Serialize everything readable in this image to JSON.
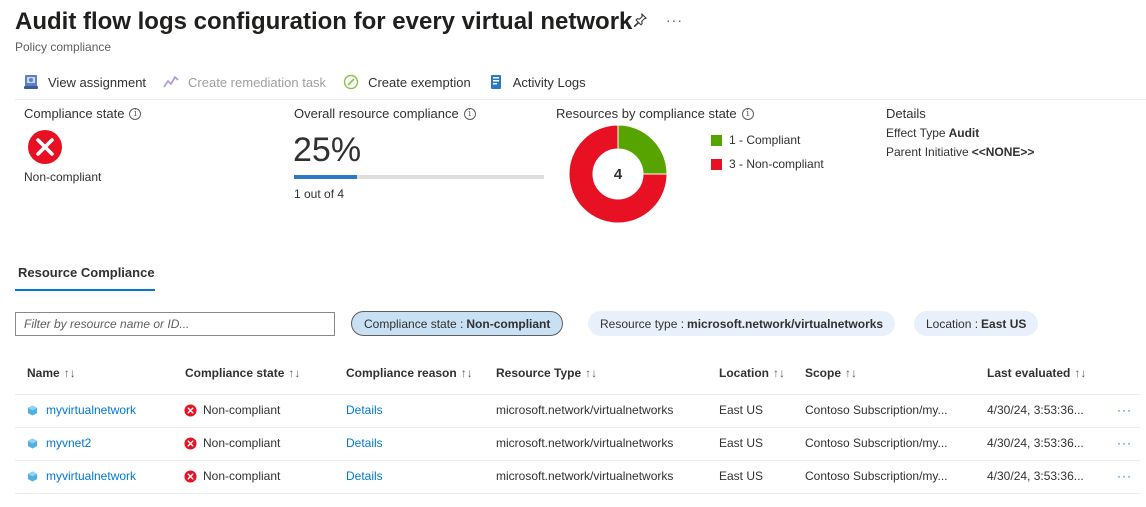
{
  "header": {
    "title": "Audit flow logs configuration for every virtual network",
    "subtitle": "Policy compliance",
    "more_label": "···"
  },
  "toolbar": {
    "view_assignment": "View assignment",
    "create_remediation": "Create remediation task",
    "create_exemption": "Create exemption",
    "activity_logs": "Activity Logs"
  },
  "summary": {
    "compliance_state_label": "Compliance state",
    "compliance_state_value": "Non-compliant",
    "overall_label": "Overall resource compliance",
    "overall_percent": "25%",
    "overall_fraction": 0.25,
    "overall_sub": "1 out of 4",
    "by_state_label": "Resources by compliance state",
    "donut_total": "4",
    "legend": [
      {
        "label": "1 - Compliant",
        "color": "#57a300",
        "count": 1
      },
      {
        "label": "3 - Non-compliant",
        "color": "#e81123",
        "count": 3
      }
    ],
    "details_label": "Details",
    "effect_type_label": "Effect Type",
    "effect_type_value": "Audit",
    "parent_initiative_label": "Parent Initiative",
    "parent_initiative_value": "<<NONE>>"
  },
  "tabs": {
    "resource_compliance": "Resource Compliance"
  },
  "filters": {
    "search_placeholder": "Filter by resource name or ID...",
    "pills": [
      {
        "key": "Compliance state :",
        "value": "Non-compliant"
      },
      {
        "key": "Resource type :",
        "value": "microsoft.network/virtualnetworks"
      },
      {
        "key": "Location :",
        "value": "East US"
      }
    ]
  },
  "table": {
    "columns": [
      "Name",
      "Compliance state",
      "Compliance reason",
      "Resource Type",
      "Location",
      "Scope",
      "Last evaluated"
    ],
    "sort_glyph": "↑↓",
    "rows": [
      {
        "name": "myvirtualnetwork",
        "state": "Non-compliant",
        "reason": "Details",
        "type": "microsoft.network/virtualnetworks",
        "location": "East US",
        "scope": "Contoso Subscription/my...",
        "evaluated": "4/30/24, 3:53:36...",
        "more": "···"
      },
      {
        "name": "myvnet2",
        "state": "Non-compliant",
        "reason": "Details",
        "type": "microsoft.network/virtualnetworks",
        "location": "East US",
        "scope": "Contoso Subscription/my...",
        "evaluated": "4/30/24, 3:53:36...",
        "more": "···"
      },
      {
        "name": "myvirtualnetwork",
        "state": "Non-compliant",
        "reason": "Details",
        "type": "microsoft.network/virtualnetworks",
        "location": "East US",
        "scope": "Contoso Subscription/my...",
        "evaluated": "4/30/24, 3:53:36...",
        "more": "···"
      }
    ]
  },
  "colors": {
    "accent": "#0078d4",
    "error": "#e81123",
    "success": "#57a300"
  }
}
